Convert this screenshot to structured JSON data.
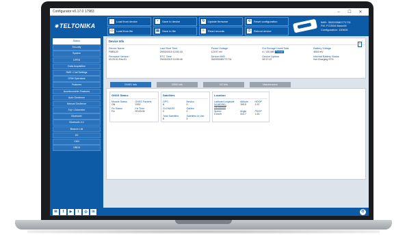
{
  "window": {
    "title": "Configurator v0.17.0 17983",
    "controls": [
      "–",
      "☐",
      "✕"
    ]
  },
  "brand": {
    "logo_text": "TELTONIKA"
  },
  "toolbar": {
    "buttons": [
      {
        "label": "Load from device",
        "icon": "download-icon"
      },
      {
        "label": "Save to device",
        "icon": "save-icon"
      },
      {
        "label": "Update firmware",
        "icon": "update-icon"
      },
      {
        "label": "Reset configuration",
        "icon": "reset-icon"
      },
      {
        "label": "Load from file",
        "icon": "folder-icon"
      },
      {
        "label": "Save to file",
        "icon": "file-save-icon"
      },
      {
        "label": "Read records",
        "icon": "records-icon"
      },
      {
        "label": "Reboot device",
        "icon": "reboot-icon"
      }
    ]
  },
  "device_header": {
    "imei": "IMEI: 352093080771731",
    "model": "FM: FC0534 Basic06",
    "configuration": "Configuration: 130616"
  },
  "sidebar": {
    "items": [
      {
        "label": "Status",
        "active": true
      },
      {
        "label": "Security"
      },
      {
        "label": "System"
      },
      {
        "label": "GPRS"
      },
      {
        "label": "Data Acquisition"
      },
      {
        "label": "SMS \\ Call Settings"
      },
      {
        "label": "GSM Operators"
      },
      {
        "label": "Features"
      },
      {
        "label": "Accelerometer Features"
      },
      {
        "label": "Auto Geofence"
      },
      {
        "label": "Manual Geofence"
      },
      {
        "label": "Trip \\ Odometer"
      },
      {
        "label": "Bluetooth"
      },
      {
        "label": "Bluetooth 4.0"
      },
      {
        "label": "Beacon List"
      },
      {
        "label": "I/O"
      },
      {
        "label": "CAN"
      },
      {
        "label": "OBDII"
      }
    ]
  },
  "device_info": {
    "title": "Device Info",
    "fields": [
      {
        "label": "Device Name",
        "value": "FMB120"
      },
      {
        "label": "Last Start Time",
        "value": "29/03/2019 10:51:16"
      },
      {
        "label": "Power Voltage",
        "value": "12197 mV"
      },
      {
        "label": "Ext Storage Used/Total",
        "value": "4 / 130 MB",
        "badge": "Format"
      },
      {
        "label": "Battery Voltage",
        "value": "4004 mV"
      },
      {
        "label": "Firmware Version",
        "value": "03.25.01.Rev.01"
      },
      {
        "label": "RTC Time",
        "value": "29/03/2019 10:59:49"
      },
      {
        "label": "Device IMEI",
        "value": "352093080771731"
      },
      {
        "label": "Device Uptime",
        "value": "00:17:22"
      },
      {
        "label": "Internal Battery Status",
        "value": "Not Charging 97%"
      }
    ]
  },
  "tabs": [
    {
      "label": "GNSS Info",
      "active": true
    },
    {
      "label": "GSM Info"
    },
    {
      "label": "I/O Info"
    },
    {
      "label": "Maintenance"
    }
  ],
  "gnss": {
    "status": {
      "title": "GNSS Status",
      "fields": [
        {
          "label": "Module Status",
          "value": "ON"
        },
        {
          "label": "GNSS Packets",
          "value": "1932"
        },
        {
          "label": "Fix Status",
          "value": "Fix"
        },
        {
          "label": "Fix Time",
          "value": "00:00:05"
        }
      ]
    },
    "satellites": {
      "title": "Satellites",
      "fields": [
        {
          "label": "GPS",
          "value": "8"
        },
        {
          "label": "Beidou",
          "value": "0"
        },
        {
          "label": "GLONASS",
          "value": "0"
        },
        {
          "label": "Galileo",
          "value": "0"
        },
        {
          "label": "Total Satellites",
          "value": "8"
        },
        {
          "label": "Satellites In Use",
          "value": "5"
        }
      ]
    },
    "location": {
      "title": "Location",
      "fields": [
        {
          "label": "Latitude/Longitude",
          "value": "54.681961, 25.255343",
          "link": true
        },
        {
          "label": "Altitude",
          "value": "195.5"
        },
        {
          "label": "HDOP",
          "value": "1.57"
        },
        {
          "label": "Speed",
          "value": "0 km/h"
        },
        {
          "label": "Angle",
          "value": "313.7"
        },
        {
          "label": "PDOP",
          "value": "1.61"
        }
      ]
    }
  },
  "footer": {
    "social": [
      {
        "icon": "email-icon",
        "glyph": "✉"
      },
      {
        "icon": "facebook-icon",
        "glyph": "f"
      },
      {
        "icon": "youtube-icon",
        "glyph": "▶"
      },
      {
        "icon": "twitter-icon",
        "glyph": "t"
      },
      {
        "icon": "instagram-icon",
        "glyph": "◎"
      },
      {
        "icon": "linkedin-icon",
        "glyph": "in"
      }
    ],
    "settings_glyph": "⚙"
  },
  "colors": {
    "brand": "#0d5aa7",
    "accent": "#2a72bc"
  }
}
